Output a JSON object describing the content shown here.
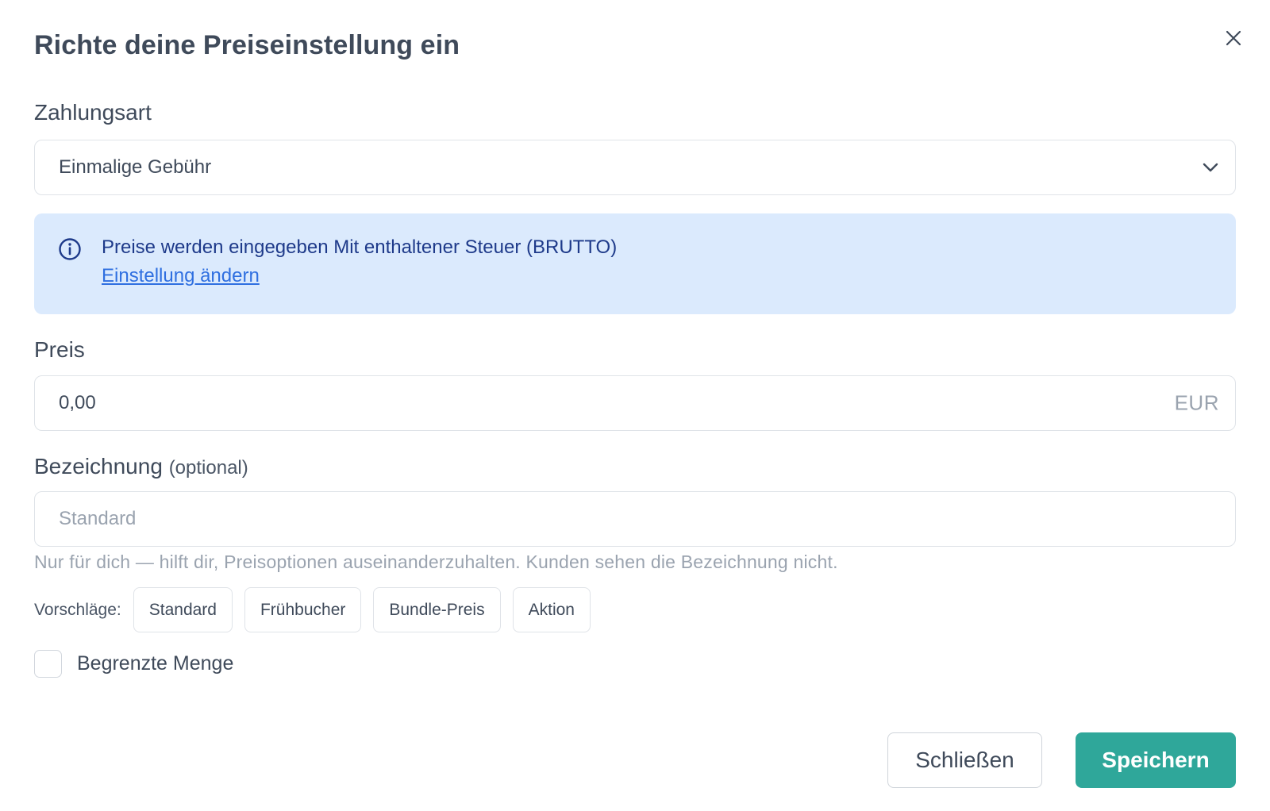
{
  "modal": {
    "title": "Richte deine Preiseinstellung ein"
  },
  "payment_type": {
    "label": "Zahlungsart",
    "selected": "Einmalige Gebühr"
  },
  "info": {
    "text": "Preise werden eingegeben Mit enthaltener Steuer (BRUTTO)",
    "link": "Einstellung ändern"
  },
  "price": {
    "label": "Preis",
    "value": "0,00",
    "currency": "EUR"
  },
  "designation": {
    "label": "Bezeichnung",
    "optional": "(optional)",
    "placeholder": "Standard",
    "hint": "Nur für dich — hilft dir, Preisoptionen auseinanderzuhalten. Kunden sehen die Bezeichnung nicht."
  },
  "suggestions": {
    "label": "Vorschläge:",
    "items": [
      "Standard",
      "Frühbucher",
      "Bundle-Preis",
      "Aktion"
    ]
  },
  "limited_quantity": {
    "label": "Begrenzte Menge",
    "checked": false
  },
  "footer": {
    "close_label": "Schließen",
    "save_label": "Speichern"
  },
  "colors": {
    "primary": "#2fa79a",
    "info_bg": "#dbeafd",
    "info_text": "#1e3a8a",
    "link": "#2f6fe0",
    "text": "#3f4a5a",
    "muted": "#9aa3af",
    "border": "#dfe3e8"
  }
}
